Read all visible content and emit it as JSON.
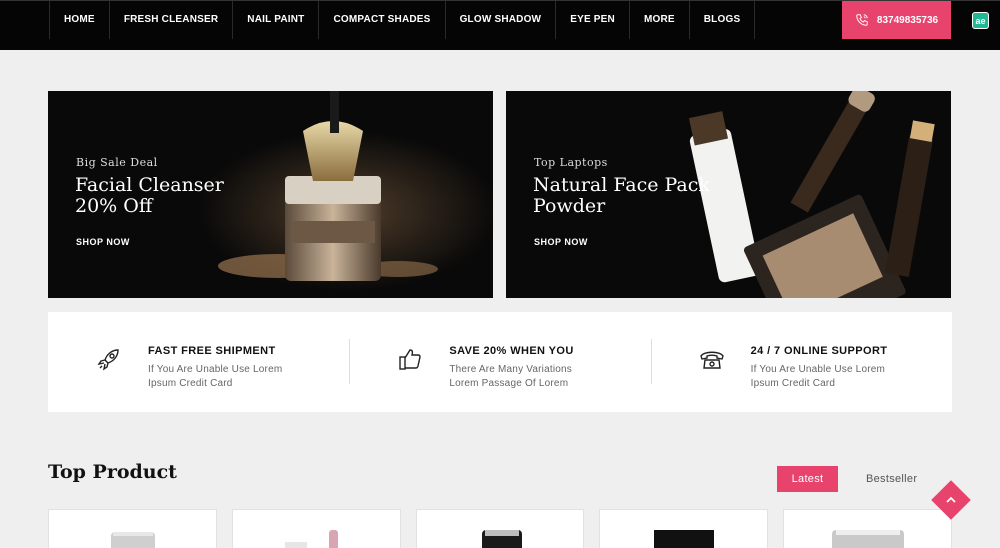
{
  "nav": {
    "items": [
      "HOME",
      "FRESH CLEANSER",
      "NAIL PAINT",
      "COMPACT SHADES",
      "GLOW SHADOW",
      "EYE PEN",
      "MORE",
      "BLOGS"
    ],
    "phone": "83749835736",
    "phone_icon": "phone-icon",
    "logo_text": "ae"
  },
  "banners": [
    {
      "eyebrow": "Big Sale Deal",
      "title_line1": "Facial Cleanser",
      "title_line2": "20% Off",
      "cta": "SHOP NOW",
      "image": "powder-brush-jar"
    },
    {
      "eyebrow": "Top Laptops",
      "title_line1": "Natural Face Pack",
      "title_line2": "Powder",
      "cta": "SHOP NOW",
      "image": "makeup-products"
    }
  ],
  "features": [
    {
      "icon": "rocket-icon",
      "title": "FAST FREE SHIPMENT",
      "desc_line1": "If You Are Unable Use Lorem",
      "desc_line2": "Ipsum Credit Card"
    },
    {
      "icon": "thumbs-up-icon",
      "title": "SAVE 20% WHEN YOU",
      "desc_line1": "There Are Many Variations",
      "desc_line2": "Lorem Passage Of Lorem"
    },
    {
      "icon": "telephone-icon",
      "title": "24 / 7 ONLINE SUPPORT",
      "desc_line1": "If You Are Unable Use Lorem",
      "desc_line2": "Ipsum Credit Card"
    }
  ],
  "top_product": {
    "title": "Top Product",
    "tabs": [
      "Latest",
      "Bestseller"
    ],
    "active_tab": "Latest"
  },
  "colors": {
    "accent": "#e8436c",
    "nav_bg": "#050505",
    "page_bg": "#efefef"
  }
}
